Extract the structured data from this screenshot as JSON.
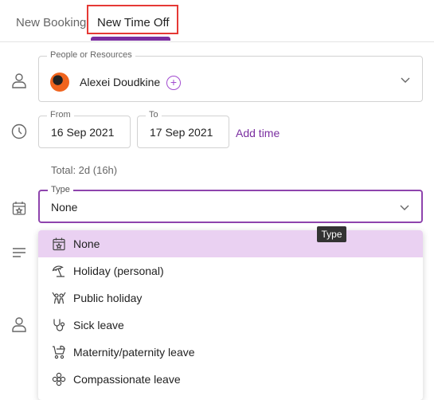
{
  "tabs": {
    "booking": "New Booking",
    "time_off": "New Time Off"
  },
  "people": {
    "legend": "People or Resources",
    "name": "Alexei Doudkine",
    "add_symbol": "+"
  },
  "dates": {
    "from_legend": "From",
    "from_value": "16 Sep 2021",
    "to_legend": "To",
    "to_value": "17 Sep 2021",
    "add_time": "Add time"
  },
  "total": "Total: 2d (16h)",
  "type": {
    "legend": "Type",
    "value": "None",
    "tooltip": "Type"
  },
  "options": [
    {
      "label": "None",
      "icon": "calendar-star-icon",
      "selected": true
    },
    {
      "label": "Holiday (personal)",
      "icon": "umbrella-beach-icon",
      "selected": false
    },
    {
      "label": "Public holiday",
      "icon": "people-celebrate-icon",
      "selected": false
    },
    {
      "label": "Sick leave",
      "icon": "stethoscope-icon",
      "selected": false
    },
    {
      "label": "Maternity/paternity leave",
      "icon": "stroller-icon",
      "selected": false
    },
    {
      "label": "Compassionate leave",
      "icon": "flower-icon",
      "selected": false
    }
  ],
  "colors": {
    "accent": "#7a2ea0",
    "selected_bg": "#ead1f2",
    "highlight_box": "#e53935"
  }
}
